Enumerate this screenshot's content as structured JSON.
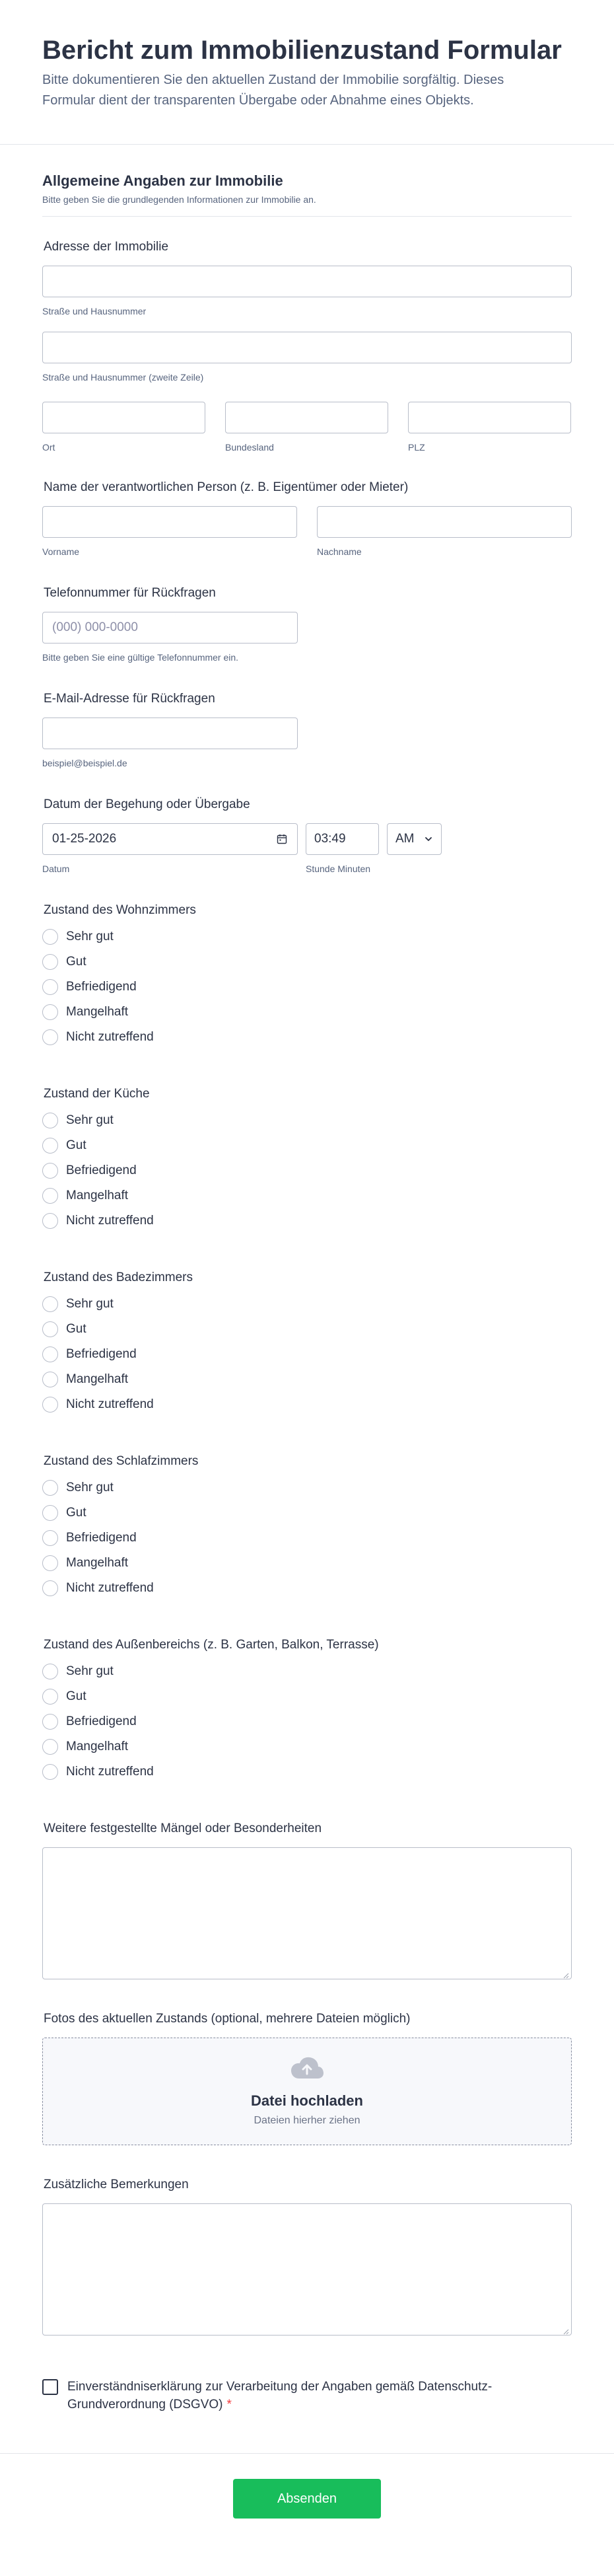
{
  "header": {
    "title": "Bericht zum Immobilienzustand Formular",
    "subtitle": "Bitte dokumentieren Sie den aktuellen Zustand der Immobilie sorgfältig. Dieses Formular dient der transparenten Übergabe oder Abnahme eines Objekts."
  },
  "section": {
    "title": "Allgemeine Angaben zur Immobilie",
    "description": "Bitte geben Sie die grundlegenden Informationen zur Immobilie an."
  },
  "address": {
    "label": "Adresse der Immobilie",
    "street_sub": "Straße und Hausnummer",
    "street2_sub": "Straße und Hausnummer (zweite Zeile)",
    "city_sub": "Ort",
    "state_sub": "Bundesland",
    "zip_sub": "PLZ"
  },
  "name": {
    "label": "Name der verantwortlichen Person (z. B. Eigentümer oder Mieter)",
    "first_sub": "Vorname",
    "last_sub": "Nachname"
  },
  "phone": {
    "label": "Telefonnummer für Rückfragen",
    "placeholder": "(000) 000-0000",
    "sub": "Bitte geben Sie eine gültige Telefonnummer ein."
  },
  "email": {
    "label": "E-Mail-Adresse für Rückfragen",
    "sub": "beispiel@beispiel.de"
  },
  "date": {
    "label": "Datum der Begehung oder Übergabe",
    "value": "01-25-2026",
    "date_sub": "Datum",
    "time_value": "03:49",
    "ampm_value": "AM",
    "time_sub": "Stunde Minuten"
  },
  "radio_options": [
    "Sehr gut",
    "Gut",
    "Befriedigend",
    "Mangelhaft",
    "Nicht zutreffend"
  ],
  "conditions": {
    "living": "Zustand des Wohnzimmers",
    "kitchen": "Zustand der Küche",
    "bathroom": "Zustand des Badezimmers",
    "bedroom": "Zustand des Schlafzimmers",
    "outdoor": "Zustand des Außenbereichs (z. B. Garten, Balkon, Terrasse)"
  },
  "defects": {
    "label": "Weitere festgestellte Mängel oder Besonderheiten"
  },
  "photos": {
    "label": "Fotos des aktuellen Zustands (optional, mehrere Dateien möglich)",
    "title": "Datei hochladen",
    "sub": "Dateien hierher ziehen"
  },
  "remarks": {
    "label": "Zusätzliche Bemerkungen"
  },
  "consent": {
    "text": "Einverständniserklärung zur Verarbeitung der Angaben gemäß Datenschutz-Grundverordnung (DSGVO)",
    "required": "*"
  },
  "submit_label": "Absenden",
  "colors": {
    "accent": "#18bd5b",
    "text": "#2c3345",
    "muted": "#57647e",
    "border": "#b8bdc9",
    "required": "#f23a3c"
  }
}
